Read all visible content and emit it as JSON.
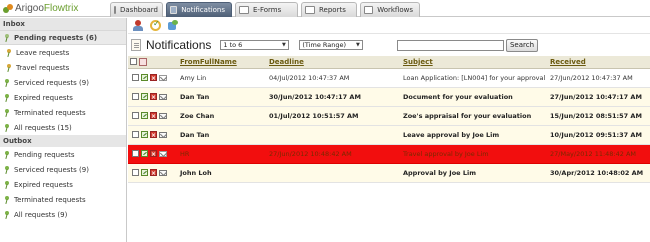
{
  "app": {
    "logo_prefix": "Arigoo",
    "logo_suffix": "Flowtrix"
  },
  "tabs": [
    {
      "label": "Dashboard"
    },
    {
      "label": "Notifications"
    },
    {
      "label": "E-Forms"
    },
    {
      "label": "Reports"
    },
    {
      "label": "Workflows"
    }
  ],
  "sidebar": {
    "inbox_label": "Inbox",
    "pending_group": "Pending requests (6)",
    "inbox_items": [
      "Leave requests",
      "Travel requests",
      "Serviced requests (9)",
      "Expired requests",
      "Terminated requests",
      "All requests (15)"
    ],
    "outbox_label": "Outbox",
    "outbox_items": [
      "Pending requests",
      "Serviced requests (9)",
      "Expired requests",
      "Terminated requests",
      "All requests (9)"
    ]
  },
  "main": {
    "title": "Notifications",
    "page_range": "1 to 6",
    "time_range": "(Time Range)",
    "search_value": "",
    "search_button": "Search"
  },
  "table": {
    "headers": {
      "from": "FromFullName",
      "deadline": "Deadline",
      "subject": "Subject",
      "received": "Received"
    },
    "rows": [
      {
        "from": "Amy Lin",
        "deadline": "04/Jul/2012 10:47:37 AM",
        "subject": "Loan Application: [LN004] for your approval",
        "received": "27/Jun/2012 10:47:37 AM"
      },
      {
        "from": "Dan Tan",
        "deadline": "30/Jun/2012 10:47:17 AM",
        "subject": "Document for your evaluation",
        "received": "27/Jun/2012 10:47:17 AM"
      },
      {
        "from": "Zoe Chan",
        "deadline": "01/Jul/2012 10:51:57 AM",
        "subject": "Zoe's appraisal for your evaluation",
        "received": "15/Jun/2012 08:51:57 AM"
      },
      {
        "from": "Dan Tan",
        "deadline": "",
        "subject": "Leave approval by Joe Lim",
        "received": "10/Jun/2012 09:51:37 AM"
      },
      {
        "from": "HR",
        "deadline": "27/Jun/2012 10:48:42 AM",
        "subject": "Travel approval by Joe Lim",
        "received": "27/May/2012 11:48:42 AM"
      },
      {
        "from": "John Loh",
        "deadline": "",
        "subject": "Approval by Joe Lim",
        "received": "30/Apr/2012 10:48:02 AM"
      }
    ]
  }
}
